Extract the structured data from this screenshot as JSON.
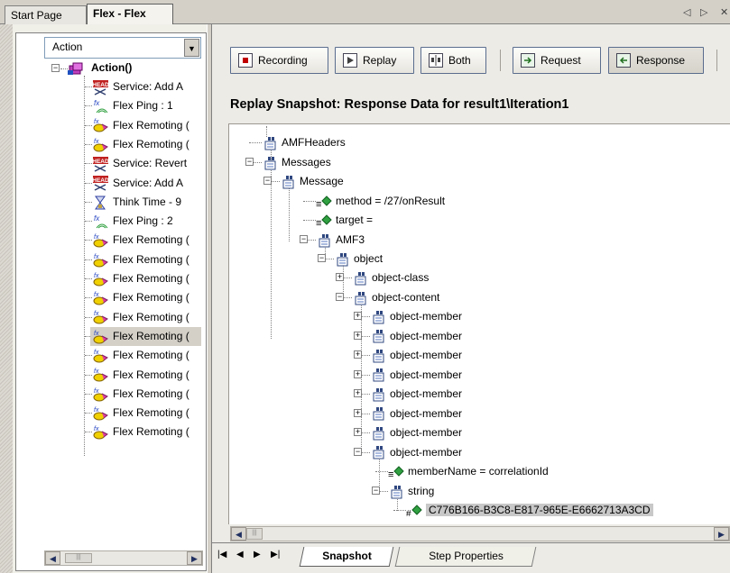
{
  "tabs": {
    "start_page": "Start Page",
    "flex": "Flex - Flex",
    "nav_left": "◁",
    "nav_right": "▷",
    "nav_close": "✕"
  },
  "left": {
    "combo_value": "Action",
    "root": "Action()",
    "items": [
      {
        "label": "Service: Add A",
        "icon": "header-icon"
      },
      {
        "label": "Flex Ping : 1",
        "icon": "flex-ping-icon"
      },
      {
        "label": "Flex Remoting (",
        "icon": "flex-remoting-icon"
      },
      {
        "label": "Flex Remoting (",
        "icon": "flex-remoting-icon"
      },
      {
        "label": "Service: Revert",
        "icon": "header-icon"
      },
      {
        "label": "Service: Add A",
        "icon": "header-icon"
      },
      {
        "label": "Think Time - 9",
        "icon": "hourglass-icon"
      },
      {
        "label": "Flex Ping : 2",
        "icon": "flex-ping-icon"
      },
      {
        "label": "Flex Remoting (",
        "icon": "flex-remoting-icon"
      },
      {
        "label": "Flex Remoting (",
        "icon": "flex-remoting-icon"
      },
      {
        "label": "Flex Remoting (",
        "icon": "flex-remoting-icon"
      },
      {
        "label": "Flex Remoting (",
        "icon": "flex-remoting-icon"
      },
      {
        "label": "Flex Remoting (",
        "icon": "flex-remoting-icon"
      },
      {
        "label": "Flex Remoting (",
        "icon": "flex-remoting-icon"
      },
      {
        "label": "Flex Remoting (",
        "icon": "flex-remoting-icon"
      },
      {
        "label": "Flex Remoting (",
        "icon": "flex-remoting-icon"
      },
      {
        "label": "Flex Remoting (",
        "icon": "flex-remoting-icon"
      },
      {
        "label": "Flex Remoting (",
        "icon": "flex-remoting-icon"
      },
      {
        "label": "Flex Remoting (",
        "icon": "flex-remoting-icon"
      }
    ],
    "selected_index": 13
  },
  "toolbar": {
    "recording": "Recording",
    "replay": "Replay",
    "both": "Both",
    "request": "Request",
    "response": "Response"
  },
  "snapshot_title": "Replay Snapshot: Response Data for result1\\Iteration1",
  "tree": {
    "amf_headers": "AMFHeaders",
    "messages": "Messages",
    "message": "Message",
    "method": "method = /27/onResult",
    "target": "target =",
    "amf3": "AMF3",
    "object": "object",
    "object_class": "object-class",
    "object_content": "object-content",
    "object_member": "object-member",
    "member_name": "memberName = correlationId",
    "string": "string",
    "value": "C776B166-B3C8-E817-965E-E6662713A3CD"
  },
  "bottom_tabs": {
    "snapshot": "Snapshot",
    "step_properties": "Step Properties"
  },
  "colors": {
    "selection": "#c8c8c8",
    "button_border": "#5a6d8e"
  }
}
